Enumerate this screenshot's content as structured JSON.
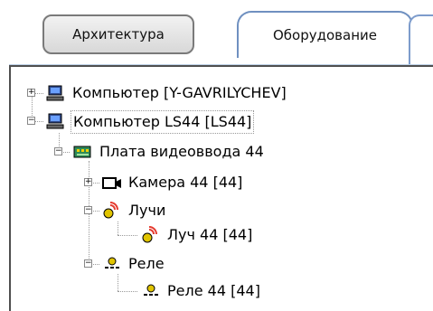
{
  "tabs": {
    "architecture": "Архитектура",
    "equipment": "Оборудование"
  },
  "tree": {
    "items": [
      {
        "label": "Компьютер [Y-GAVRILYCHEV]",
        "icon": "computer-icon"
      },
      {
        "label": "Компьютер LS44 [LS44]",
        "icon": "computer-icon"
      },
      {
        "label": "Плата видеоввода 44",
        "icon": "capture-board-icon"
      },
      {
        "label": "Камера 44 [44]",
        "icon": "camera-icon"
      },
      {
        "label": "Лучи",
        "icon": "rays-icon"
      },
      {
        "label": "Луч 44 [44]",
        "icon": "ray-icon"
      },
      {
        "label": "Реле",
        "icon": "relay-icon"
      },
      {
        "label": "Реле 44 [44]",
        "icon": "relay-item-icon"
      }
    ]
  },
  "colors": {
    "background": "#ffffff",
    "active_tab_border": "#6f90c0",
    "inactive_tab_border": "#7a7a7a",
    "tree_lines": "#9a9a9a",
    "icon_red": "#e53b2f",
    "icon_yellow": "#e0c400",
    "icon_green": "#16a34a"
  }
}
